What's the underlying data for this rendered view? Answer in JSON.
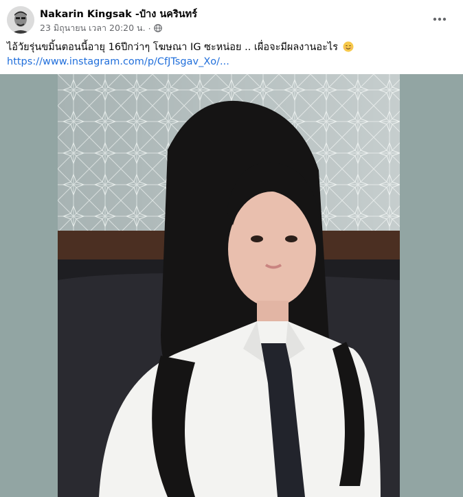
{
  "post": {
    "author": "Nakarin Kingsak -ป๋าง นครินทร์",
    "timestamp": "23 มิถุนายน เวลา 20:20 น.",
    "separator": "·",
    "privacy_icon": "globe-icon",
    "more_icon": "more-horizontal-icon",
    "caption": "ไอ้วัยรุ่นขมิ้นตอนนี้อายุ 16ปีกว่าๆ โฆษณา IG ซะหน่อย .. เผื่อจะมีผลงานอะไร",
    "caption_emoji": "smiling-face-icon",
    "link_text": "https://www.instagram.com/p/CfJTsgav_Xo/..."
  },
  "colors": {
    "author_text": "#050505",
    "meta_text": "#65676b",
    "link": "#216fdb",
    "media_background": "#92a5a3"
  }
}
